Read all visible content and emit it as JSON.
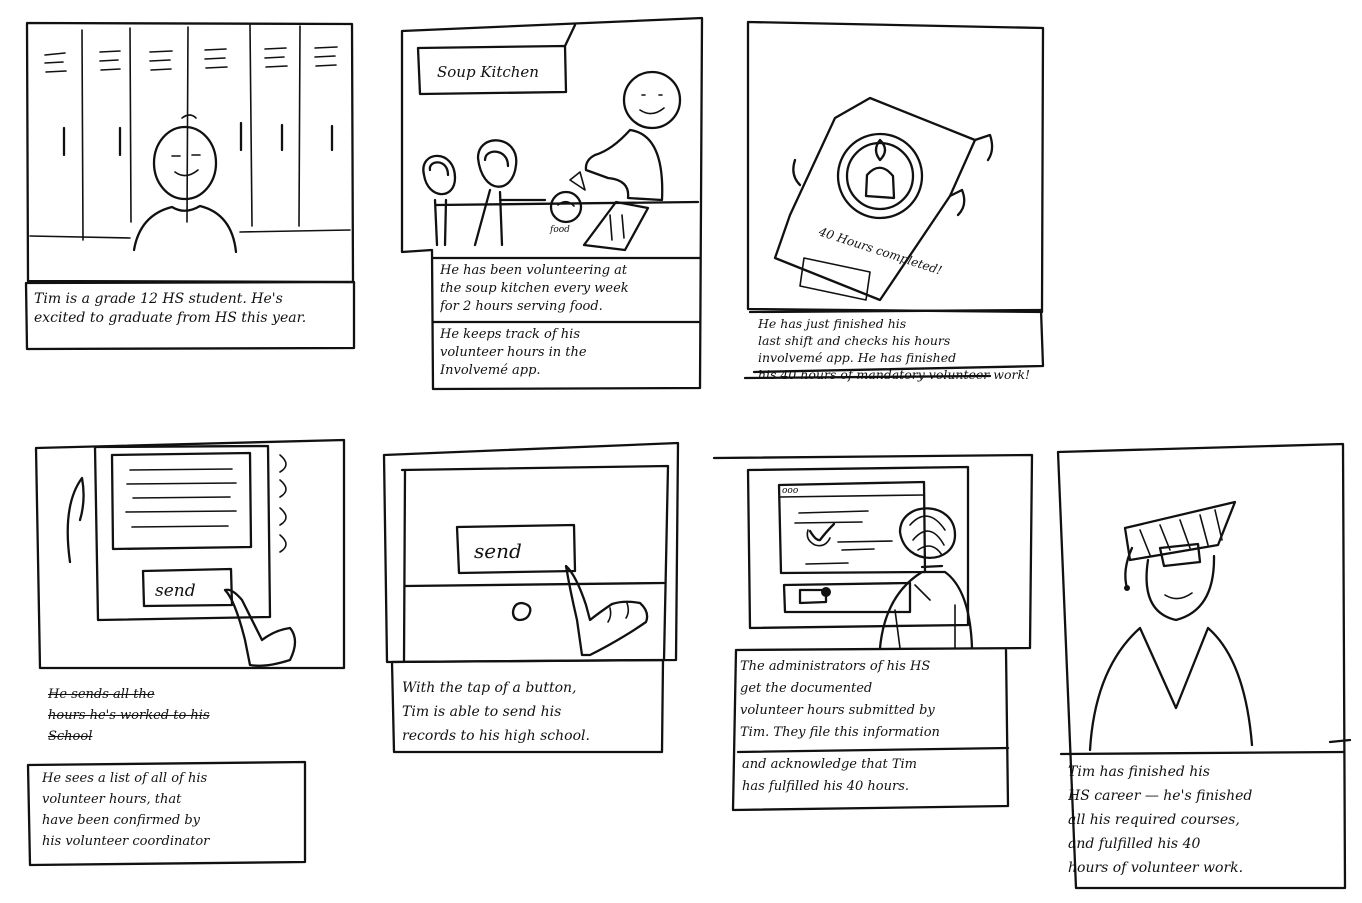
{
  "storyboard": {
    "panels": [
      {
        "scene": {
          "sign": ""
        },
        "caption": "Tim is a grade 12 HS student. He's\nexcited to graduate from HS this year."
      },
      {
        "scene": {
          "sign": "Soup Kitchen",
          "food_label": "food"
        },
        "caption": "He has been volunteering at\nthe soup kitchen every week\nfor 2 hours serving food.",
        "caption2": "He keeps track of his\nvolunteer hours in the\nInvolvemé app."
      },
      {
        "scene": {
          "badge_text": "40 Hours completed!"
        },
        "caption": "He has just finished his\nlast shift and checks his hours\ninvolvemé app. He has finished\nhis 40 hours of mandatory volunteer work!"
      },
      {
        "scene": {
          "button_label": "send"
        },
        "caption_struck": "He sends all the\nhours he's worked to his\nSchool",
        "caption": "He sees a list of all of his\nvolunteer hours, that\nhave been confirmed by\nhis volunteer coordinator"
      },
      {
        "scene": {
          "button_label": "send"
        },
        "caption": "With the tap of a button,\nTim is able to send his\nrecords to his high school."
      },
      {
        "scene": {
          "window_dots": "ooo"
        },
        "caption": "The administrators of his HS\nget the documented\nvolunteer hours submitted by\nTim. They file this information",
        "caption2": "and acknowledge that Tim\nhas fulfilled his 40 hours."
      },
      {
        "scene": {},
        "caption": "Tim has finished his\nHS career — he's finished\nall his required courses,\nand fulfilled his 40\nhours of volunteer work."
      }
    ]
  }
}
